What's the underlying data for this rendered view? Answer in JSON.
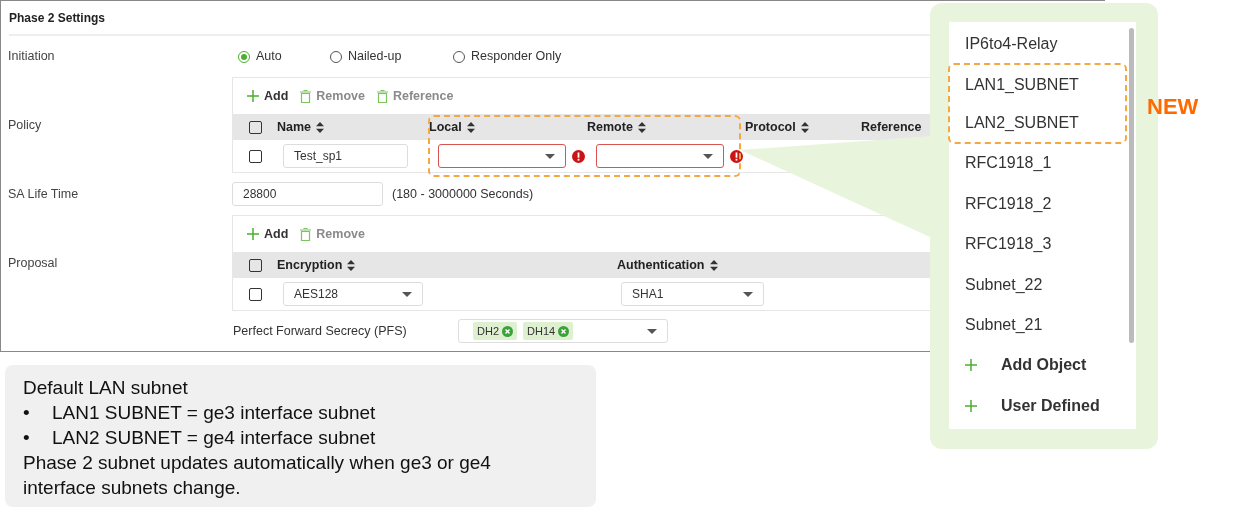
{
  "panel": {
    "title": "Phase 2 Settings"
  },
  "initiation": {
    "label": "Initiation",
    "options": [
      {
        "label": "Auto",
        "selected": true
      },
      {
        "label": "Nailed-up",
        "selected": false
      },
      {
        "label": "Responder Only",
        "selected": false
      }
    ]
  },
  "policy": {
    "label": "Policy",
    "toolbar": [
      {
        "kind": "add",
        "label": "Add",
        "disabled": false
      },
      {
        "kind": "remove",
        "label": "Remove",
        "disabled": true
      },
      {
        "kind": "reference",
        "label": "Reference",
        "disabled": true
      }
    ],
    "columns": [
      {
        "label": "Name",
        "sortable": true
      },
      {
        "label": "Local",
        "sortable": true
      },
      {
        "label": "Remote",
        "sortable": true
      },
      {
        "label": "Protocol",
        "sortable": true
      },
      {
        "label": "Reference",
        "sortable": false
      }
    ],
    "all_checked": false,
    "rows": [
      {
        "checked": false,
        "name": "Test_sp1",
        "local_error": true,
        "remote_error": true
      }
    ]
  },
  "sa_life_time": {
    "label": "SA Life Time",
    "value": "28800",
    "hint": "(180 - 3000000 Seconds)"
  },
  "proposal": {
    "label": "Proposal",
    "toolbar": [
      {
        "kind": "add",
        "label": "Add",
        "disabled": false
      },
      {
        "kind": "remove",
        "label": "Remove",
        "disabled": true
      }
    ],
    "columns": [
      {
        "label": "Encryption",
        "sortable": true
      },
      {
        "label": "Authentication",
        "sortable": true
      }
    ],
    "all_checked": false,
    "rows": [
      {
        "checked": false,
        "encryption": "AES128",
        "authentication": "SHA1"
      }
    ]
  },
  "pfs": {
    "label": "Perfect Forward Secrecy (PFS)",
    "tags": [
      "DH2",
      "DH14"
    ]
  },
  "dropdown": {
    "badge": "NEW",
    "items": [
      {
        "kind": "option",
        "label": "IP6to4-Relay",
        "new": false
      },
      {
        "kind": "option",
        "label": "LAN1_SUBNET",
        "new": true
      },
      {
        "kind": "option",
        "label": "LAN2_SUBNET",
        "new": true
      },
      {
        "kind": "option",
        "label": "RFC1918_1",
        "new": false
      },
      {
        "kind": "option",
        "label": "RFC1918_2",
        "new": false
      },
      {
        "kind": "option",
        "label": "RFC1918_3",
        "new": false
      },
      {
        "kind": "option",
        "label": "Subnet_22",
        "new": false
      },
      {
        "kind": "option",
        "label": "Subnet_21",
        "new": false
      },
      {
        "kind": "action",
        "label": "Add Object",
        "new": false
      },
      {
        "kind": "action",
        "label": "User Defined",
        "new": false
      }
    ]
  },
  "note": {
    "title": "Default LAN subnet",
    "bullets": [
      {
        "marker": "•",
        "text": "LAN1 SUBNET = ge3 interface subnet"
      },
      {
        "marker": "•",
        "text": "LAN2 SUBNET = ge4 interface subnet"
      }
    ],
    "text": "Phase 2 subnet updates automatically when ge3 or ge4 interface subnets change."
  }
}
